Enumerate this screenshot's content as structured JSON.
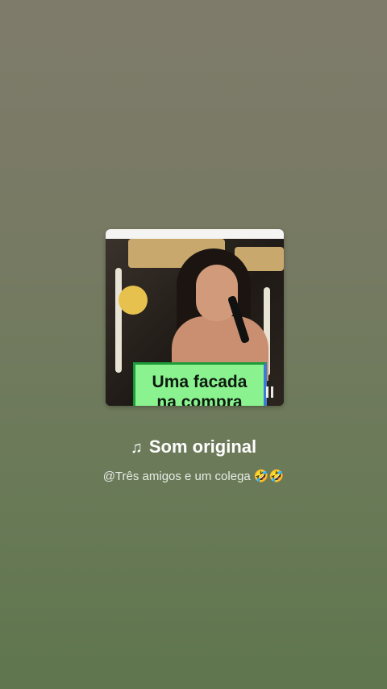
{
  "sound": {
    "title": "Som original",
    "note_icon": "music-note-icon",
    "subtitle": "@Três amigos e um colega 🤣🤣"
  },
  "thumbnail": {
    "caption": "Uma facada na compra",
    "pause_icon": "pause-icon"
  },
  "colors": {
    "caption_bg": "#8af28e",
    "text_primary": "#ffffff"
  }
}
